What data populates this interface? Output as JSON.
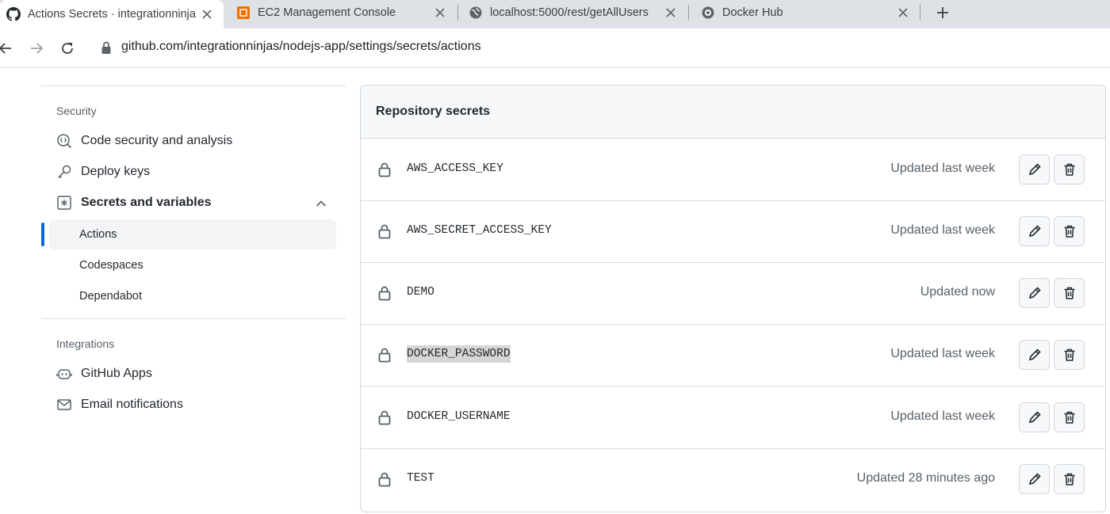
{
  "browser": {
    "tabs": [
      {
        "title": "Actions Secrets · integrationninja",
        "icon": "github-icon",
        "active": true
      },
      {
        "title": "EC2 Management Console",
        "icon": "aws-icon",
        "active": false
      },
      {
        "title": "localhost:5000/rest/getAllUsers",
        "icon": "globe-icon",
        "active": false
      },
      {
        "title": "Docker Hub",
        "icon": "docker-icon",
        "active": false
      }
    ],
    "url": "github.com/integrationninjas/nodejs-app/settings/secrets/actions"
  },
  "sidebar": {
    "security_heading": "Security",
    "items": [
      {
        "label": "Code security and analysis",
        "icon": "codescan-icon"
      },
      {
        "label": "Deploy keys",
        "icon": "key-icon"
      },
      {
        "label": "Secrets and variables",
        "icon": "asterisk-icon"
      }
    ],
    "sub_items": [
      {
        "label": "Actions",
        "active": true
      },
      {
        "label": "Codespaces"
      },
      {
        "label": "Dependabot"
      }
    ],
    "integrations_heading": "Integrations",
    "integration_items": [
      {
        "label": "GitHub Apps",
        "icon": "robot-icon"
      },
      {
        "label": "Email notifications",
        "icon": "mail-icon"
      }
    ]
  },
  "secrets": {
    "title": "Repository secrets",
    "rows": [
      {
        "name": "AWS_ACCESS_KEY",
        "updated": "Updated last week"
      },
      {
        "name": "AWS_SECRET_ACCESS_KEY",
        "updated": "Updated last week"
      },
      {
        "name": "DEMO",
        "updated": "Updated now"
      },
      {
        "name": "DOCKER_PASSWORD",
        "updated": "Updated last week",
        "highlighted": true
      },
      {
        "name": "DOCKER_USERNAME",
        "updated": "Updated last week"
      },
      {
        "name": "TEST",
        "updated": "Updated 28 minutes ago"
      }
    ]
  },
  "colors": {
    "accent": "#0969da",
    "tabstrip": "#dee1e6",
    "header_bg": "#f6f8fa"
  }
}
